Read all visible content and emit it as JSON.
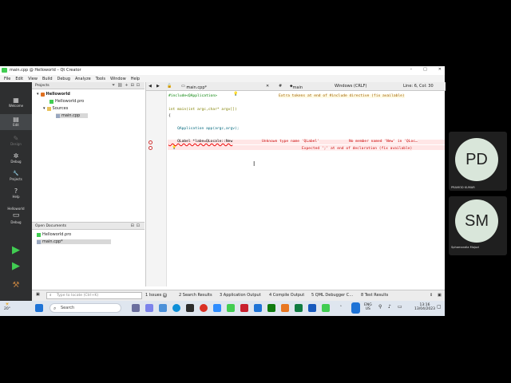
{
  "window": {
    "title": "main.cpp @ Helloworld – Qt Creator",
    "controls": [
      "–",
      "□",
      "✕"
    ]
  },
  "menu": [
    "File",
    "Edit",
    "View",
    "Build",
    "Debug",
    "Analyze",
    "Tools",
    "Window",
    "Help"
  ],
  "modes": [
    {
      "label": "Welcome",
      "icon": "grid-icon",
      "glyph": "▦",
      "state": "normal"
    },
    {
      "label": "Edit",
      "icon": "edit-icon",
      "glyph": "▤",
      "state": "active"
    },
    {
      "label": "Design",
      "icon": "design-icon",
      "glyph": "✎",
      "state": "disabled"
    },
    {
      "label": "Debug",
      "icon": "debug-icon",
      "glyph": "✲",
      "state": "normal"
    },
    {
      "label": "Projects",
      "icon": "wrench-icon",
      "glyph": "🔧",
      "state": "normal"
    },
    {
      "label": "Help",
      "icon": "help-icon",
      "glyph": "?",
      "state": "normal"
    }
  ],
  "kit": {
    "project": "Helloworld",
    "config": "Debug"
  },
  "projects_panel": {
    "title": "Projects",
    "tree": [
      {
        "label": "Helloworld",
        "level": 0,
        "icon": "project-icon",
        "bold": true
      },
      {
        "label": "Helloworld.pro",
        "level": 1,
        "icon": "pro-file-icon"
      },
      {
        "label": "Sources",
        "level": 1,
        "icon": "folder-icon"
      },
      {
        "label": "main.cpp",
        "level": 2,
        "icon": "cpp-file-icon",
        "selected": true
      }
    ]
  },
  "open_documents": {
    "title": "Open Documents",
    "items": [
      {
        "label": "Helloworld.pro",
        "selected": false
      },
      {
        "label": "main.cpp*",
        "selected": true
      }
    ]
  },
  "editor": {
    "file_tab": "main.cpp*",
    "symbol": "main",
    "encoding": "Windows (CRLF)",
    "position": "Line: 6, Col: 30",
    "lines": {
      "l1": "#include<QApplication>",
      "l3": "int main(int argc,char* argv[])",
      "l4": "{",
      "l6a": "    QApplication app(argc,argv);",
      "l7": "    QLabel *labe=QLocale::New"
    },
    "annotations": {
      "a1": "Extra tokens at end of #include directive (fix available)",
      "a2": "Unknown type name 'QLabel'",
      "a3": "No member named 'New' in 'QLoc…",
      "a4": "Expected ';' at end of declaration (fix available)"
    }
  },
  "output_bar": {
    "locator_placeholder": "Type to locate (Ctrl+K)",
    "tabs": [
      "1  Issues",
      "2  Search Results",
      "3  Application Output",
      "4  Compile Output",
      "5  QML Debugger C…",
      "8  Test Results"
    ],
    "issues_count": "4"
  },
  "taskbar": {
    "weather": "20°",
    "search_label": "Search",
    "lang": "ENG",
    "region": "US",
    "time": "13:16",
    "date": "13/04/2023"
  },
  "participants": [
    {
      "initials": "PD",
      "name": "PRAMOD KUMAR"
    },
    {
      "initials": "SM",
      "name": "Sphamandla Majozi"
    }
  ],
  "colors": {
    "qt_green": "#41cd52",
    "mode_bar": "#2e2f30",
    "error": "#cc0000"
  }
}
